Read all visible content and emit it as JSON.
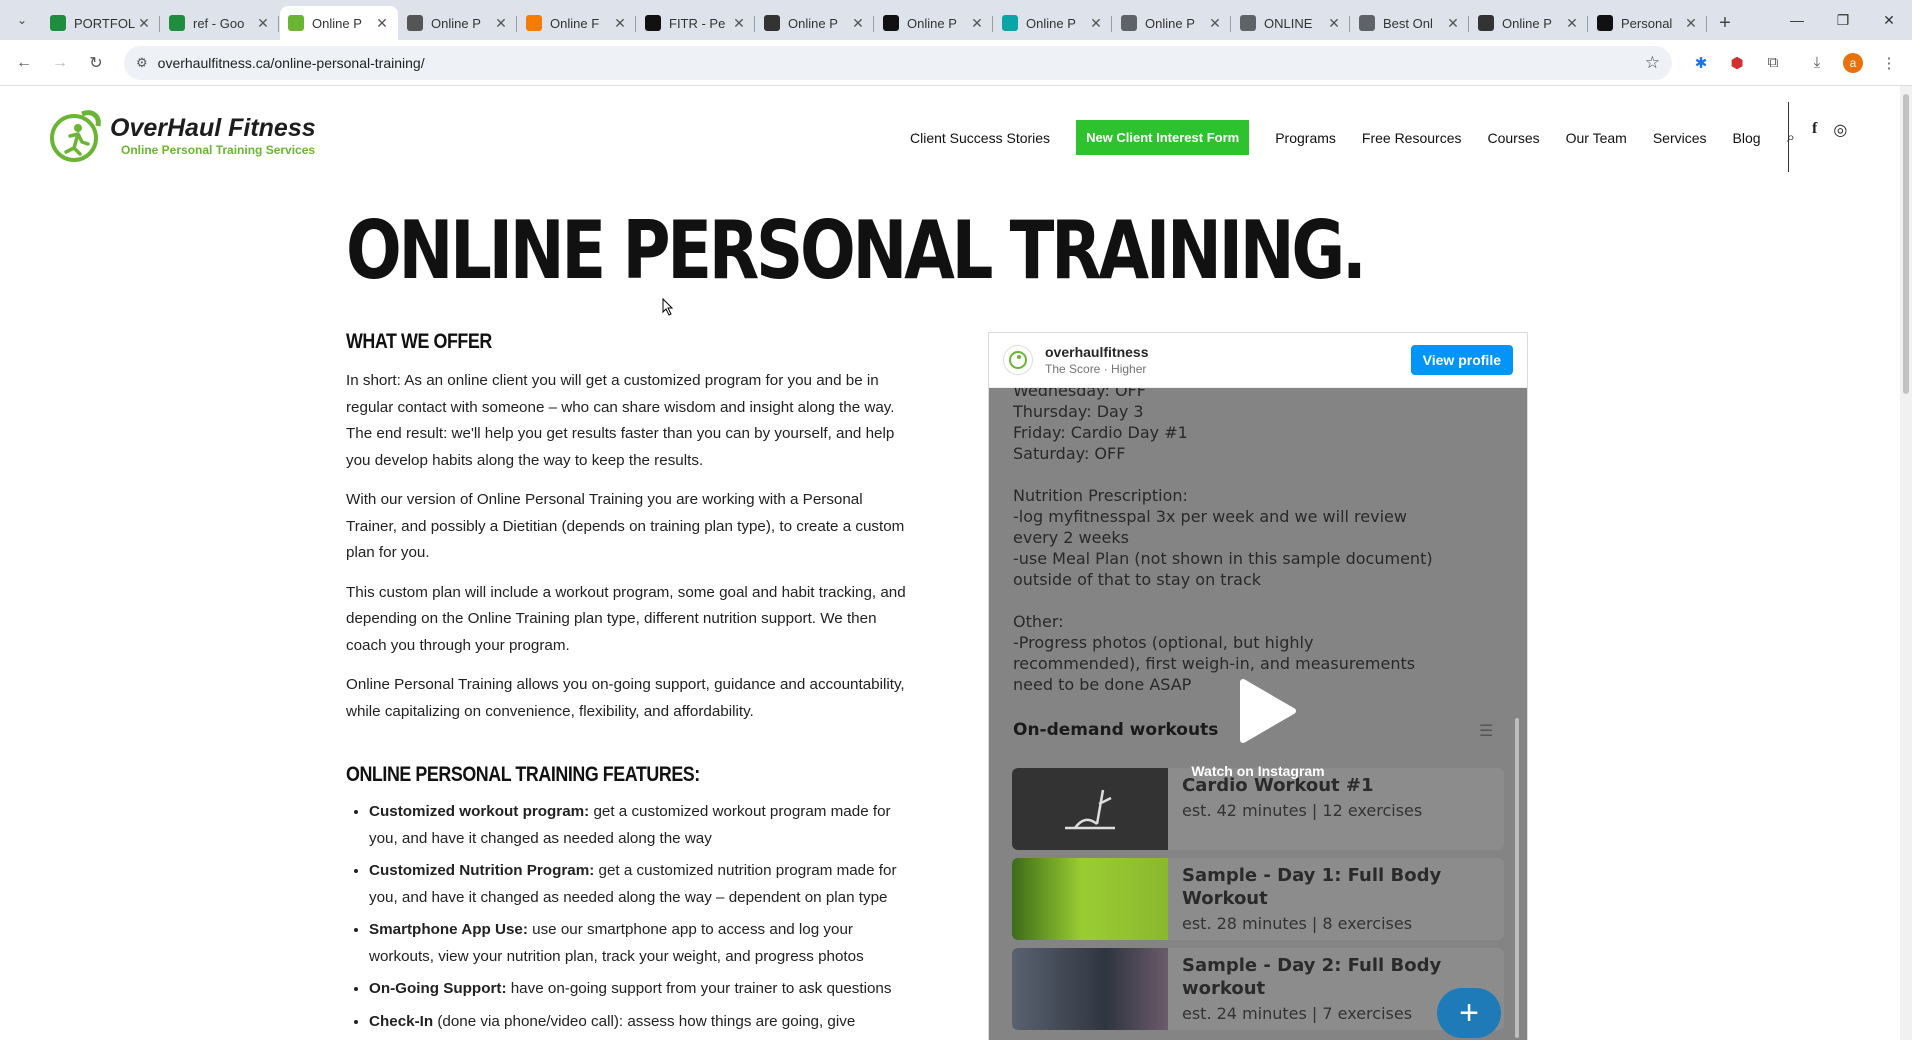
{
  "browser": {
    "tabs": [
      {
        "title": "PORTFOL",
        "favicon": "sheets-icon",
        "color": "#1e8e3e"
      },
      {
        "title": "ref - Goo",
        "favicon": "sheets-icon",
        "color": "#1e8e3e"
      },
      {
        "title": "Online P",
        "favicon": "overhaul-icon",
        "color": "#6ab533",
        "active": true
      },
      {
        "title": "Online P",
        "favicon": "coach-icon",
        "color": "#555555"
      },
      {
        "title": "Online F",
        "favicon": "flame-icon",
        "color": "#f57c00"
      },
      {
        "title": "FITR - Pe",
        "favicon": "fitr-icon",
        "color": "#111111"
      },
      {
        "title": "Online P",
        "favicon": "cube-icon",
        "color": "#333333"
      },
      {
        "title": "Online P",
        "favicon": "k-icon",
        "color": "#111111"
      },
      {
        "title": "Online P",
        "favicon": "swirl-icon",
        "color": "#0aa5a5"
      },
      {
        "title": "Online P",
        "favicon": "globe-icon",
        "color": "#5f6368"
      },
      {
        "title": "ONLINE",
        "favicon": "circle-icon",
        "color": "#5f6368"
      },
      {
        "title": "Best Onl",
        "favicon": "globe-icon",
        "color": "#5f6368"
      },
      {
        "title": "Online P",
        "favicon": "mountain-icon",
        "color": "#333333"
      },
      {
        "title": "Personal",
        "favicon": "fs-icon",
        "color": "#111111"
      }
    ],
    "url": "overhaulfitness.ca/online-personal-training/",
    "profile_initial": "a"
  },
  "site": {
    "logo_name": "OverHaul Fitness",
    "logo_tagline": "Online Personal Training Services",
    "nav": [
      "Client Success Stories",
      "New Client Interest Form",
      "Programs",
      "Free Resources",
      "Courses",
      "Our Team",
      "Services",
      "Blog"
    ],
    "cta_color": "#2ec22e"
  },
  "main": {
    "title": "ONLINE PERSONAL TRAINING.",
    "section1_heading": "WHAT WE OFFER",
    "paragraphs": [
      "In short: As an online client you will get a customized program for you and be in regular contact with someone – who can share wisdom and insight along the way. The end result: we'll help you get results faster than you can by yourself, and help you develop habits along the way to keep the results.",
      "With our version of Online Personal Training you are working with a Personal Trainer, and possibly a Dietitian (depends on training plan type), to create a custom plan for you.",
      "This custom plan will include a workout program, some goal and habit tracking, and depending on the Online Training plan type, different nutrition support. We then coach you through your program.",
      "Online Personal Training allows you on-going support, guidance and accountability, while capitalizing on convenience, flexibility, and affordability."
    ],
    "section2_heading": "ONLINE PERSONAL TRAINING FEATURES:",
    "features": [
      {
        "bold": "Customized workout program:",
        "text": " get a customized workout program made for you, and have it changed as needed along the way"
      },
      {
        "bold": "Customized Nutrition Program:",
        "text": " get a customized nutrition program made for you, and have it changed as needed along the way – dependent on plan type"
      },
      {
        "bold": "Smartphone App Use:",
        "text": " use our smartphone app to access and log your workouts, view your nutrition plan, track your weight, and progress photos"
      },
      {
        "bold": "On-Going Support:",
        "text": " have on-going support from your trainer to ask questions"
      },
      {
        "bold": "Check-In",
        "text": " (done via phone/video call): assess how things are going, give"
      }
    ]
  },
  "instagram": {
    "username": "overhaulfitness",
    "subtitle": "The Score · Higher",
    "view_profile": "View profile",
    "post_text": "Wednesday: OFF\nThursday: Day 3\nFriday: Cardio Day #1\nSaturday: OFF\n\nNutrition Prescription:\n-log myfitnesspal 3x per week and we will review\nevery 2 weeks\n-use Meal Plan (not shown in this sample document)\noutside of that to stay on track\n\nOther:\n-Progress photos (optional, but highly\nrecommended), first weigh-in, and measurements\nneed to be done ASAP",
    "on_demand": "On-demand workouts",
    "watch_label": "Watch on Instagram",
    "workouts": [
      {
        "title": "Cardio Workout #1",
        "meta": "est. 42 minutes | 12 exercises"
      },
      {
        "title": "Sample - Day 1: Full Body Workout",
        "meta": "est. 28 minutes | 8 exercises"
      },
      {
        "title": "Sample - Day 2: Full Body workout",
        "meta": "est. 24 minutes | 7 exercises"
      }
    ]
  }
}
